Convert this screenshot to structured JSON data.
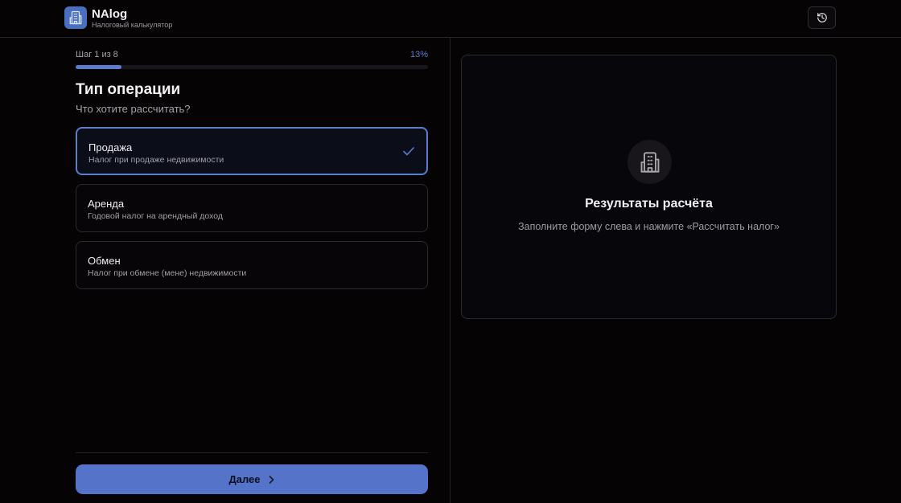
{
  "app": {
    "title": "NAlog",
    "subtitle": "Налоговый калькулятор",
    "logo_icon": "building-icon",
    "history_icon": "history-icon"
  },
  "colors": {
    "accent": "#5b7dd0",
    "background": "#060304",
    "button": "#5473c9"
  },
  "wizard": {
    "step_label": "Шаг 1 из 8",
    "progress_text": "13%",
    "progress_fraction": 0.13,
    "title": "Тип операции",
    "question": "Что хотите рассчитать?",
    "options": [
      {
        "title": "Продажа",
        "description": "Налог при продаже недвижимости",
        "selected": true
      },
      {
        "title": "Аренда",
        "description": "Годовой налог на арендный доход",
        "selected": false
      },
      {
        "title": "Обмен",
        "description": "Налог при обмене (мене) недвижимости",
        "selected": false
      }
    ],
    "next_label": "Далее",
    "next_icon": "chevron-right-icon"
  },
  "results": {
    "icon": "building-icon",
    "title": "Результаты расчёта",
    "hint": "Заполните форму слева и нажмите «Рассчитать налог»"
  }
}
